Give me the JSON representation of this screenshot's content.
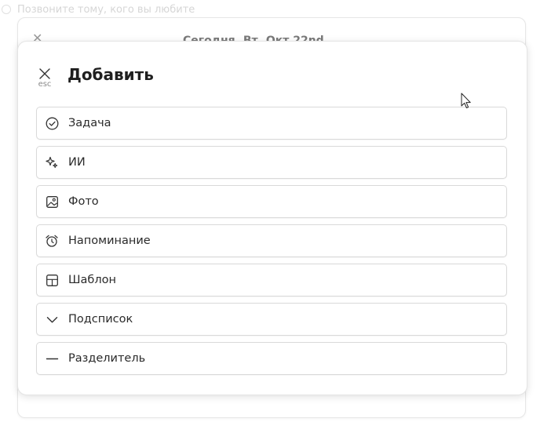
{
  "background": {
    "hint_text": "Позвоните тому, кого вы любите",
    "header_title": "Сегодня, Вт, Окт 22nd",
    "close_icon": "close-icon"
  },
  "modal": {
    "title": "Добавить",
    "close_icon": "close-icon",
    "close_hint": "esc",
    "items": [
      {
        "label": "Задача",
        "icon": "check-circle-icon"
      },
      {
        "label": "ИИ",
        "icon": "sparkles-icon"
      },
      {
        "label": "Фото",
        "icon": "image-icon"
      },
      {
        "label": "Напоминание",
        "icon": "alarm-clock-icon"
      },
      {
        "label": "Шаблон",
        "icon": "template-icon"
      },
      {
        "label": "Подсписок",
        "icon": "chevron-down-icon"
      },
      {
        "label": "Разделитель",
        "icon": "divider-icon"
      }
    ]
  },
  "colors": {
    "text": "#2a2a2a",
    "border": "#d9d9d9",
    "muted": "#8a8a8a"
  }
}
